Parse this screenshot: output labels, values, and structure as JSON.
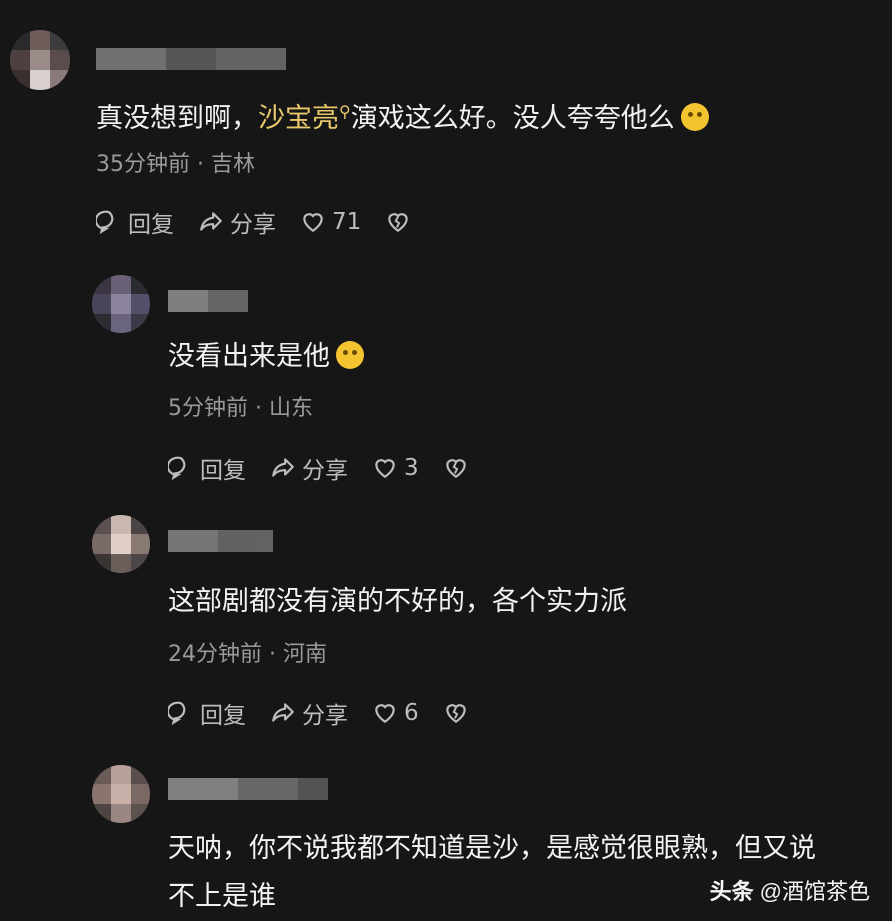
{
  "comments": [
    {
      "text_before": "真没想到啊，",
      "highlight": "沙宝亮",
      "text_after": "演戏这么好。没人夸夸他么",
      "time": "35分钟前",
      "location": "吉林",
      "reply_label": "回复",
      "share_label": "分享",
      "likes": "71"
    },
    {
      "text": "没看出来是他",
      "time": "5分钟前",
      "location": "山东",
      "reply_label": "回复",
      "share_label": "分享",
      "likes": "3"
    },
    {
      "text": "这部剧都没有演的不好的，各个实力派",
      "time": "24分钟前",
      "location": "河南",
      "reply_label": "回复",
      "share_label": "分享",
      "likes": "6"
    },
    {
      "text_line1": "天呐，你不说我都不知道是沙，是感觉很眼熟，但又说",
      "text_line2": "不上是谁"
    }
  ],
  "meta_separator": "·",
  "watermark": {
    "brand": "头条",
    "handle": "@酒馆茶色"
  }
}
